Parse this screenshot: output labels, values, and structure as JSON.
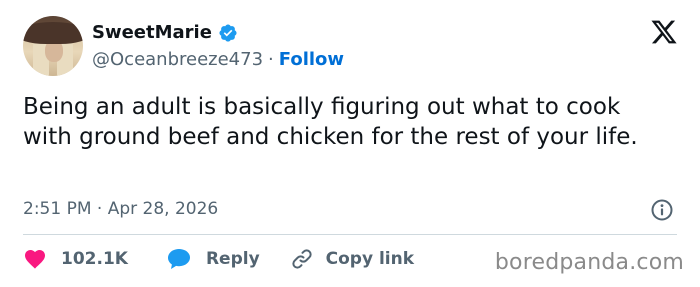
{
  "author": {
    "display_name": "SweetMarie",
    "handle": "@Oceanbreeze473",
    "separator": "·",
    "follow_label": "Follow",
    "verified": true,
    "verified_color": "#1d9bf0"
  },
  "tweet": {
    "text": "Being an adult is basically figuring out what to cook with ground beef and chicken for the rest of your life.",
    "timestamp": "2:51 PM · Apr 28, 2026"
  },
  "actions": {
    "likes_count": "102.1K",
    "reply_label": "Reply",
    "copy_link_label": "Copy link",
    "like_color": "#f91880",
    "reply_color": "#1d9bf0"
  },
  "icons": [
    "verified-badge-icon",
    "x-logo-icon",
    "info-icon",
    "heart-icon",
    "reply-bubble-icon",
    "link-icon"
  ],
  "watermark": "boredpanda.com",
  "colors": {
    "text": "#0f1419",
    "muted": "#536471",
    "link": "#006fd6",
    "divider": "#cfd9de"
  }
}
